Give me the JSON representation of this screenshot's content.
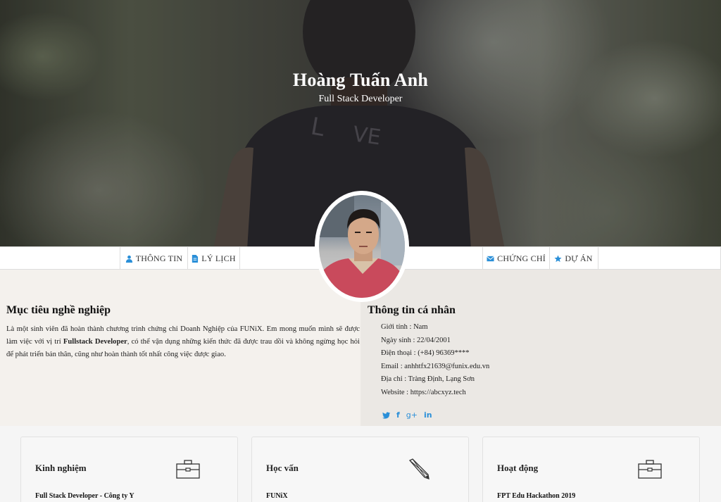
{
  "hero": {
    "name": "Hoàng Tuấn Anh",
    "role": "Full Stack Developer"
  },
  "nav": {
    "left": [
      {
        "label": "THÔNG TIN",
        "icon": "user-icon"
      },
      {
        "label": "LÝ LỊCH",
        "icon": "file-icon"
      }
    ],
    "right": [
      {
        "label": "CHỨNG CHỈ",
        "icon": "envelope-icon"
      },
      {
        "label": "DỰ ÁN",
        "icon": "star-icon"
      }
    ]
  },
  "objective": {
    "title": "Mục tiêu nghề nghiệp",
    "text_1": "Là một sinh viên đã hoàn thành chương trình chứng chỉ Doanh Nghiệp của FUNiX. Em mong muốn mình sẽ được làm việc với vị trí ",
    "highlight": "Fullstack Developer",
    "text_2": ", có thể vận dụng những kiến thức đã được trau dồi và không ngừng học hỏi để phát triển bản thân, cũng như hoàn thành tốt nhất công việc được giao."
  },
  "personal": {
    "title": "Thông tin cá nhân",
    "lines": [
      "Giới tính : Nam",
      "Ngày sinh : 22/04/2001",
      "Điện thoại : (+84) 96369****",
      "Email : anhhtfx21639@funix.edu.vn",
      "Địa chỉ : Tràng Định, Lạng Sơn",
      "Website : https://abcxyz.tech"
    ],
    "social": [
      "twitter-icon",
      "facebook-icon",
      "google-plus-icon",
      "linkedin-icon"
    ]
  },
  "cards": [
    {
      "title": "Kinh nghiệm",
      "icon": "briefcase-icon",
      "item": "Full Stack Developer - Công ty Y"
    },
    {
      "title": "Học vấn",
      "icon": "pencil-icon",
      "item": "FUNiX"
    },
    {
      "title": "Hoạt động",
      "icon": "briefcase-icon",
      "item": "FPT Edu Hackathon 2019"
    }
  ],
  "colors": {
    "accent": "#2a8fd8",
    "left_panel": "#f4f1ed",
    "right_panel": "#ebe8e4"
  }
}
